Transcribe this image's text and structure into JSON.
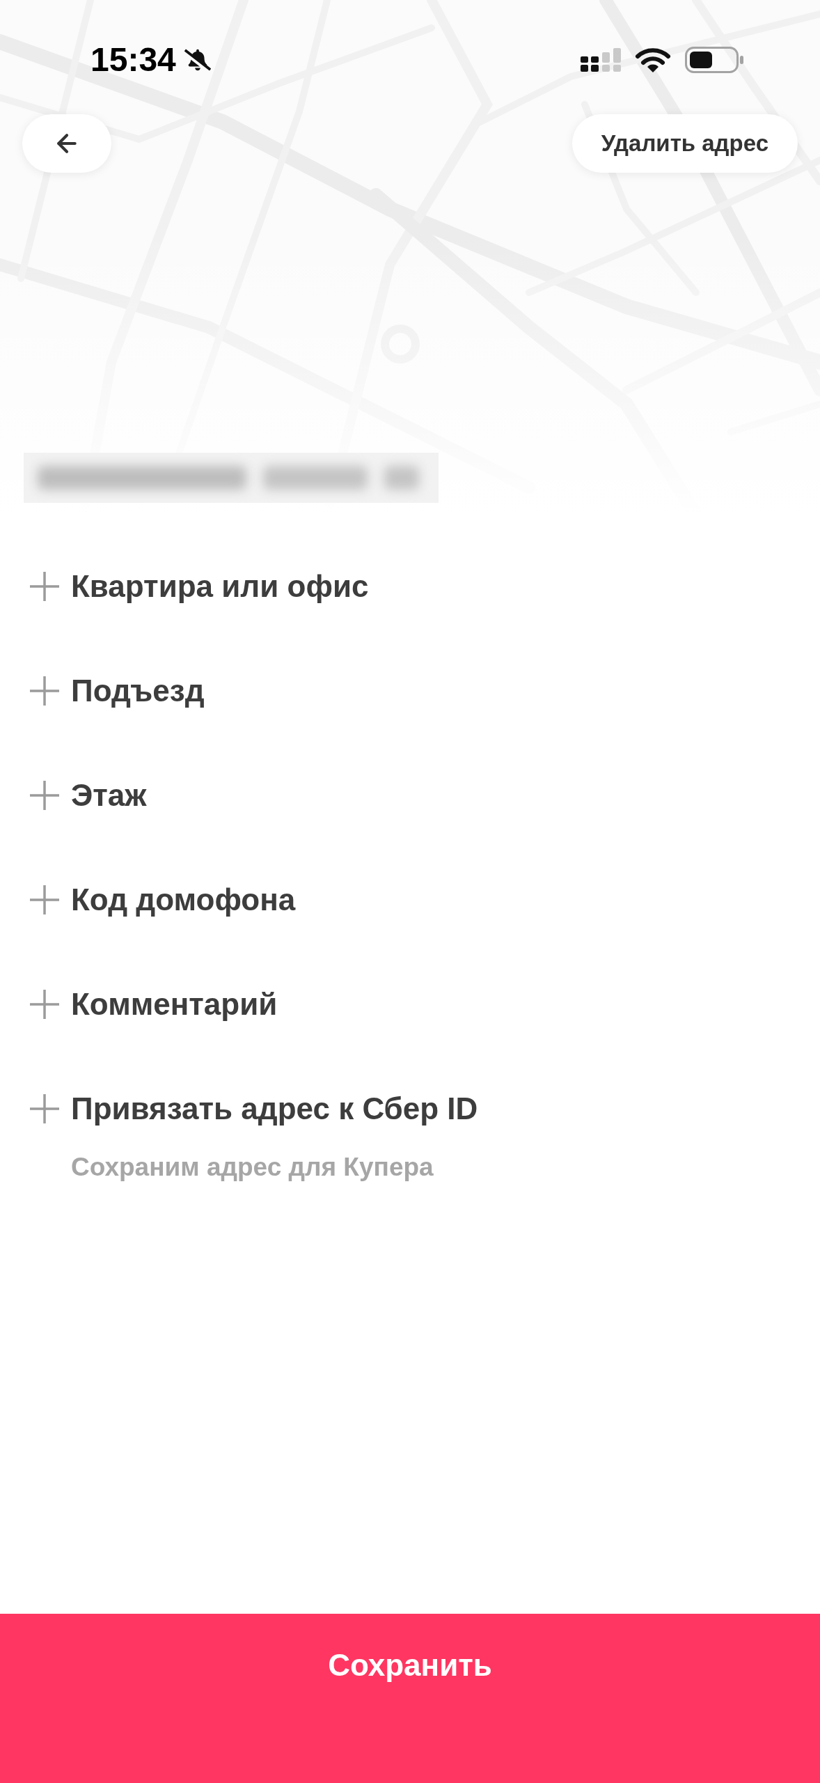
{
  "status_bar": {
    "time": "15:34",
    "silent": true
  },
  "header": {
    "delete_button": {
      "label": "Удалить адрес"
    }
  },
  "fields": [
    {
      "label": "Квартира или офис"
    },
    {
      "label": "Подъезд"
    },
    {
      "label": "Этаж"
    },
    {
      "label": "Код домофона"
    },
    {
      "label": "Комментарий"
    },
    {
      "label": "Привязать адрес к Сбер ID",
      "hint": "Сохраним адрес для Купера"
    }
  ],
  "save_button": {
    "label": "Сохранить"
  }
}
